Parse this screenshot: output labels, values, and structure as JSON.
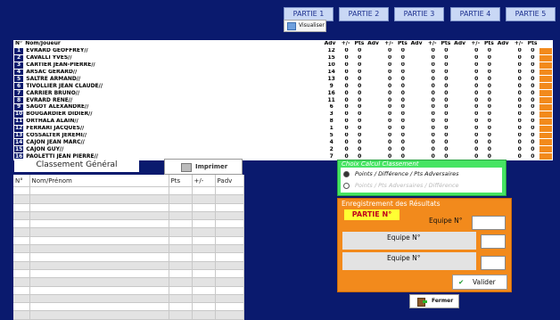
{
  "tabs": [
    "PARTIE 1",
    "PARTIE 2",
    "PARTIE 3",
    "PARTIE 4",
    "PARTIE 5"
  ],
  "visualiser_label": "Visualiser",
  "score_table": {
    "headers": {
      "num": "N°",
      "name": "Nom/Joueur",
      "adv": "Adv",
      "pm": "+/-",
      "pts": "Pts"
    },
    "rows": [
      {
        "num": "1",
        "name": "EVRARD GEOFFREY//",
        "adv": "12",
        "vals": [
          "0",
          "0"
        ]
      },
      {
        "num": "2",
        "name": "CAVALLI YVES//",
        "adv": "15",
        "vals": [
          "0",
          "0"
        ]
      },
      {
        "num": "3",
        "name": "CARTIER JEAN-PIERRE//",
        "adv": "10",
        "vals": [
          "0",
          "0"
        ]
      },
      {
        "num": "4",
        "name": "ARSAC GERARD//",
        "adv": "14",
        "vals": [
          "0",
          "0"
        ]
      },
      {
        "num": "5",
        "name": "SALTRE ARMAND//",
        "adv": "13",
        "vals": [
          "0",
          "0"
        ]
      },
      {
        "num": "6",
        "name": "TIVOLLIER JEAN CLAUDE//",
        "adv": "9",
        "vals": [
          "0",
          "0"
        ]
      },
      {
        "num": "7",
        "name": "CARRIER BRUNO//",
        "adv": "16",
        "vals": [
          "0",
          "0"
        ]
      },
      {
        "num": "8",
        "name": "EVRARD RENE//",
        "adv": "11",
        "vals": [
          "0",
          "0"
        ]
      },
      {
        "num": "9",
        "name": "SAGOT ALEXANDRE//",
        "adv": "6",
        "vals": [
          "0",
          "0"
        ]
      },
      {
        "num": "10",
        "name": "BOUGARDIER DIDIER//",
        "adv": "3",
        "vals": [
          "0",
          "0"
        ]
      },
      {
        "num": "11",
        "name": "ORTHALA ALAIN//",
        "adv": "8",
        "vals": [
          "0",
          "0"
        ]
      },
      {
        "num": "12",
        "name": "FERRARI JACQUES//",
        "adv": "1",
        "vals": [
          "0",
          "0"
        ]
      },
      {
        "num": "13",
        "name": "COSSALTER JEREMI//",
        "adv": "5",
        "vals": [
          "0",
          "0"
        ]
      },
      {
        "num": "14",
        "name": "CAJON JEAN MARC//",
        "adv": "4",
        "vals": [
          "0",
          "0"
        ]
      },
      {
        "num": "15",
        "name": "CAJON GUY//",
        "adv": "2",
        "vals": [
          "0",
          "0"
        ]
      },
      {
        "num": "16",
        "name": "PAOLETTI JEAN PIERRE//",
        "adv": "7",
        "vals": [
          "0",
          "0"
        ]
      }
    ]
  },
  "classement": {
    "title": "Classement Général",
    "imprimer_label": "Imprimer",
    "headers": [
      "N°",
      "Nom/Prénom",
      "Pts",
      "+/-",
      "Padv"
    ]
  },
  "choix": {
    "title": "Choix Calcul Classement",
    "option1": "Points / Différence / Pts Adversaires",
    "option2": "Points / Pts Adversaires / Différence"
  },
  "enregistrement": {
    "title": "Enregistrement des Résultats",
    "partie_label": "PARTIE N°",
    "equipe1": "Equipe N°",
    "equipe2": "Equipe N°",
    "equipe3": "Equipe N°",
    "valider_label": "Valider"
  },
  "fermer_label": "Fermer",
  "colors": {
    "background": "#0a1a6e",
    "orange": "#f28a1c",
    "green": "#46e463",
    "yellow": "#ffff33"
  }
}
